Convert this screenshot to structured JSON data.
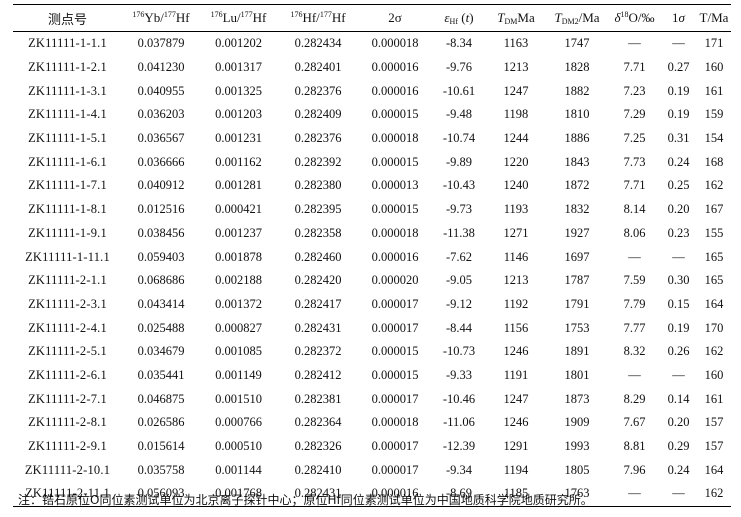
{
  "table": {
    "headers": {
      "sample": "测点号",
      "yb_hf": "176Yb/177Hf",
      "lu_hf": "176Lu/177Hf",
      "hf_hf": "176Hf/177Hf",
      "two_sigma": "2σ",
      "eps_hf": "εHf (t)",
      "tdm": "TDMMa",
      "tdm2": "TDM2/Ma",
      "d18o": "δ18O/‰",
      "one_sigma": "1σ",
      "t": "T/Ma"
    },
    "rows": [
      [
        "ZK11111-1-1.1",
        "0.037879",
        "0.001202",
        "0.282434",
        "0.000018",
        "-8.34",
        "1163",
        "1747",
        "—",
        "—",
        "171"
      ],
      [
        "ZK11111-1-2.1",
        "0.041230",
        "0.001317",
        "0.282401",
        "0.000016",
        "-9.76",
        "1213",
        "1828",
        "7.71",
        "0.27",
        "160"
      ],
      [
        "ZK11111-1-3.1",
        "0.040955",
        "0.001325",
        "0.282376",
        "0.000016",
        "-10.61",
        "1247",
        "1882",
        "7.23",
        "0.19",
        "161"
      ],
      [
        "ZK11111-1-4.1",
        "0.036203",
        "0.001203",
        "0.282409",
        "0.000015",
        "-9.48",
        "1198",
        "1810",
        "7.29",
        "0.19",
        "159"
      ],
      [
        "ZK11111-1-5.1",
        "0.036567",
        "0.001231",
        "0.282376",
        "0.000018",
        "-10.74",
        "1244",
        "1886",
        "7.25",
        "0.31",
        "154"
      ],
      [
        "ZK11111-1-6.1",
        "0.036666",
        "0.001162",
        "0.282392",
        "0.000015",
        "-9.89",
        "1220",
        "1843",
        "7.73",
        "0.24",
        "168"
      ],
      [
        "ZK11111-1-7.1",
        "0.040912",
        "0.001281",
        "0.282380",
        "0.000013",
        "-10.43",
        "1240",
        "1872",
        "7.71",
        "0.25",
        "162"
      ],
      [
        "ZK11111-1-8.1",
        "0.012516",
        "0.000421",
        "0.282395",
        "0.000015",
        "-9.73",
        "1193",
        "1832",
        "8.14",
        "0.20",
        "167"
      ],
      [
        "ZK11111-1-9.1",
        "0.038456",
        "0.001237",
        "0.282358",
        "0.000018",
        "-11.38",
        "1271",
        "1927",
        "8.06",
        "0.23",
        "155"
      ],
      [
        "ZK11111-1-11.1",
        "0.059403",
        "0.001878",
        "0.282460",
        "0.000016",
        "-7.62",
        "1146",
        "1697",
        "—",
        "—",
        "165"
      ],
      [
        "ZK11111-2-1.1",
        "0.068686",
        "0.002188",
        "0.282420",
        "0.000020",
        "-9.05",
        "1213",
        "1787",
        "7.59",
        "0.30",
        "165"
      ],
      [
        "ZK11111-2-3.1",
        "0.043414",
        "0.001372",
        "0.282417",
        "0.000017",
        "-9.12",
        "1192",
        "1791",
        "7.79",
        "0.15",
        "164"
      ],
      [
        "ZK11111-2-4.1",
        "0.025488",
        "0.000827",
        "0.282431",
        "0.000017",
        "-8.44",
        "1156",
        "1753",
        "7.77",
        "0.19",
        "170"
      ],
      [
        "ZK11111-2-5.1",
        "0.034679",
        "0.001085",
        "0.282372",
        "0.000015",
        "-10.73",
        "1246",
        "1891",
        "8.32",
        "0.26",
        "162"
      ],
      [
        "ZK11111-2-6.1",
        "0.035441",
        "0.001149",
        "0.282412",
        "0.000015",
        "-9.33",
        "1191",
        "1801",
        "—",
        "—",
        "160"
      ],
      [
        "ZK11111-2-7.1",
        "0.046875",
        "0.001510",
        "0.282381",
        "0.000017",
        "-10.46",
        "1247",
        "1873",
        "8.29",
        "0.14",
        "161"
      ],
      [
        "ZK11111-2-8.1",
        "0.026586",
        "0.000766",
        "0.282364",
        "0.000018",
        "-11.06",
        "1246",
        "1909",
        "7.67",
        "0.20",
        "157"
      ],
      [
        "ZK11111-2-9.1",
        "0.015614",
        "0.000510",
        "0.282326",
        "0.000017",
        "-12.39",
        "1291",
        "1993",
        "8.81",
        "0.29",
        "157"
      ],
      [
        "ZK11111-2-10.1",
        "0.035758",
        "0.001144",
        "0.282410",
        "0.000017",
        "-9.34",
        "1194",
        "1805",
        "7.96",
        "0.24",
        "164"
      ],
      [
        "ZK11111-2-11.1",
        "0.056093",
        "0.001768",
        "0.282431",
        "0.000016",
        "-8.69",
        "1185",
        "1763",
        "—",
        "—",
        "162"
      ]
    ]
  },
  "note": "注：锆石原位O同位素测试单位为北京离子探针中心；原位Hf同位素测试单位为中国地质科学院地质研究所。"
}
